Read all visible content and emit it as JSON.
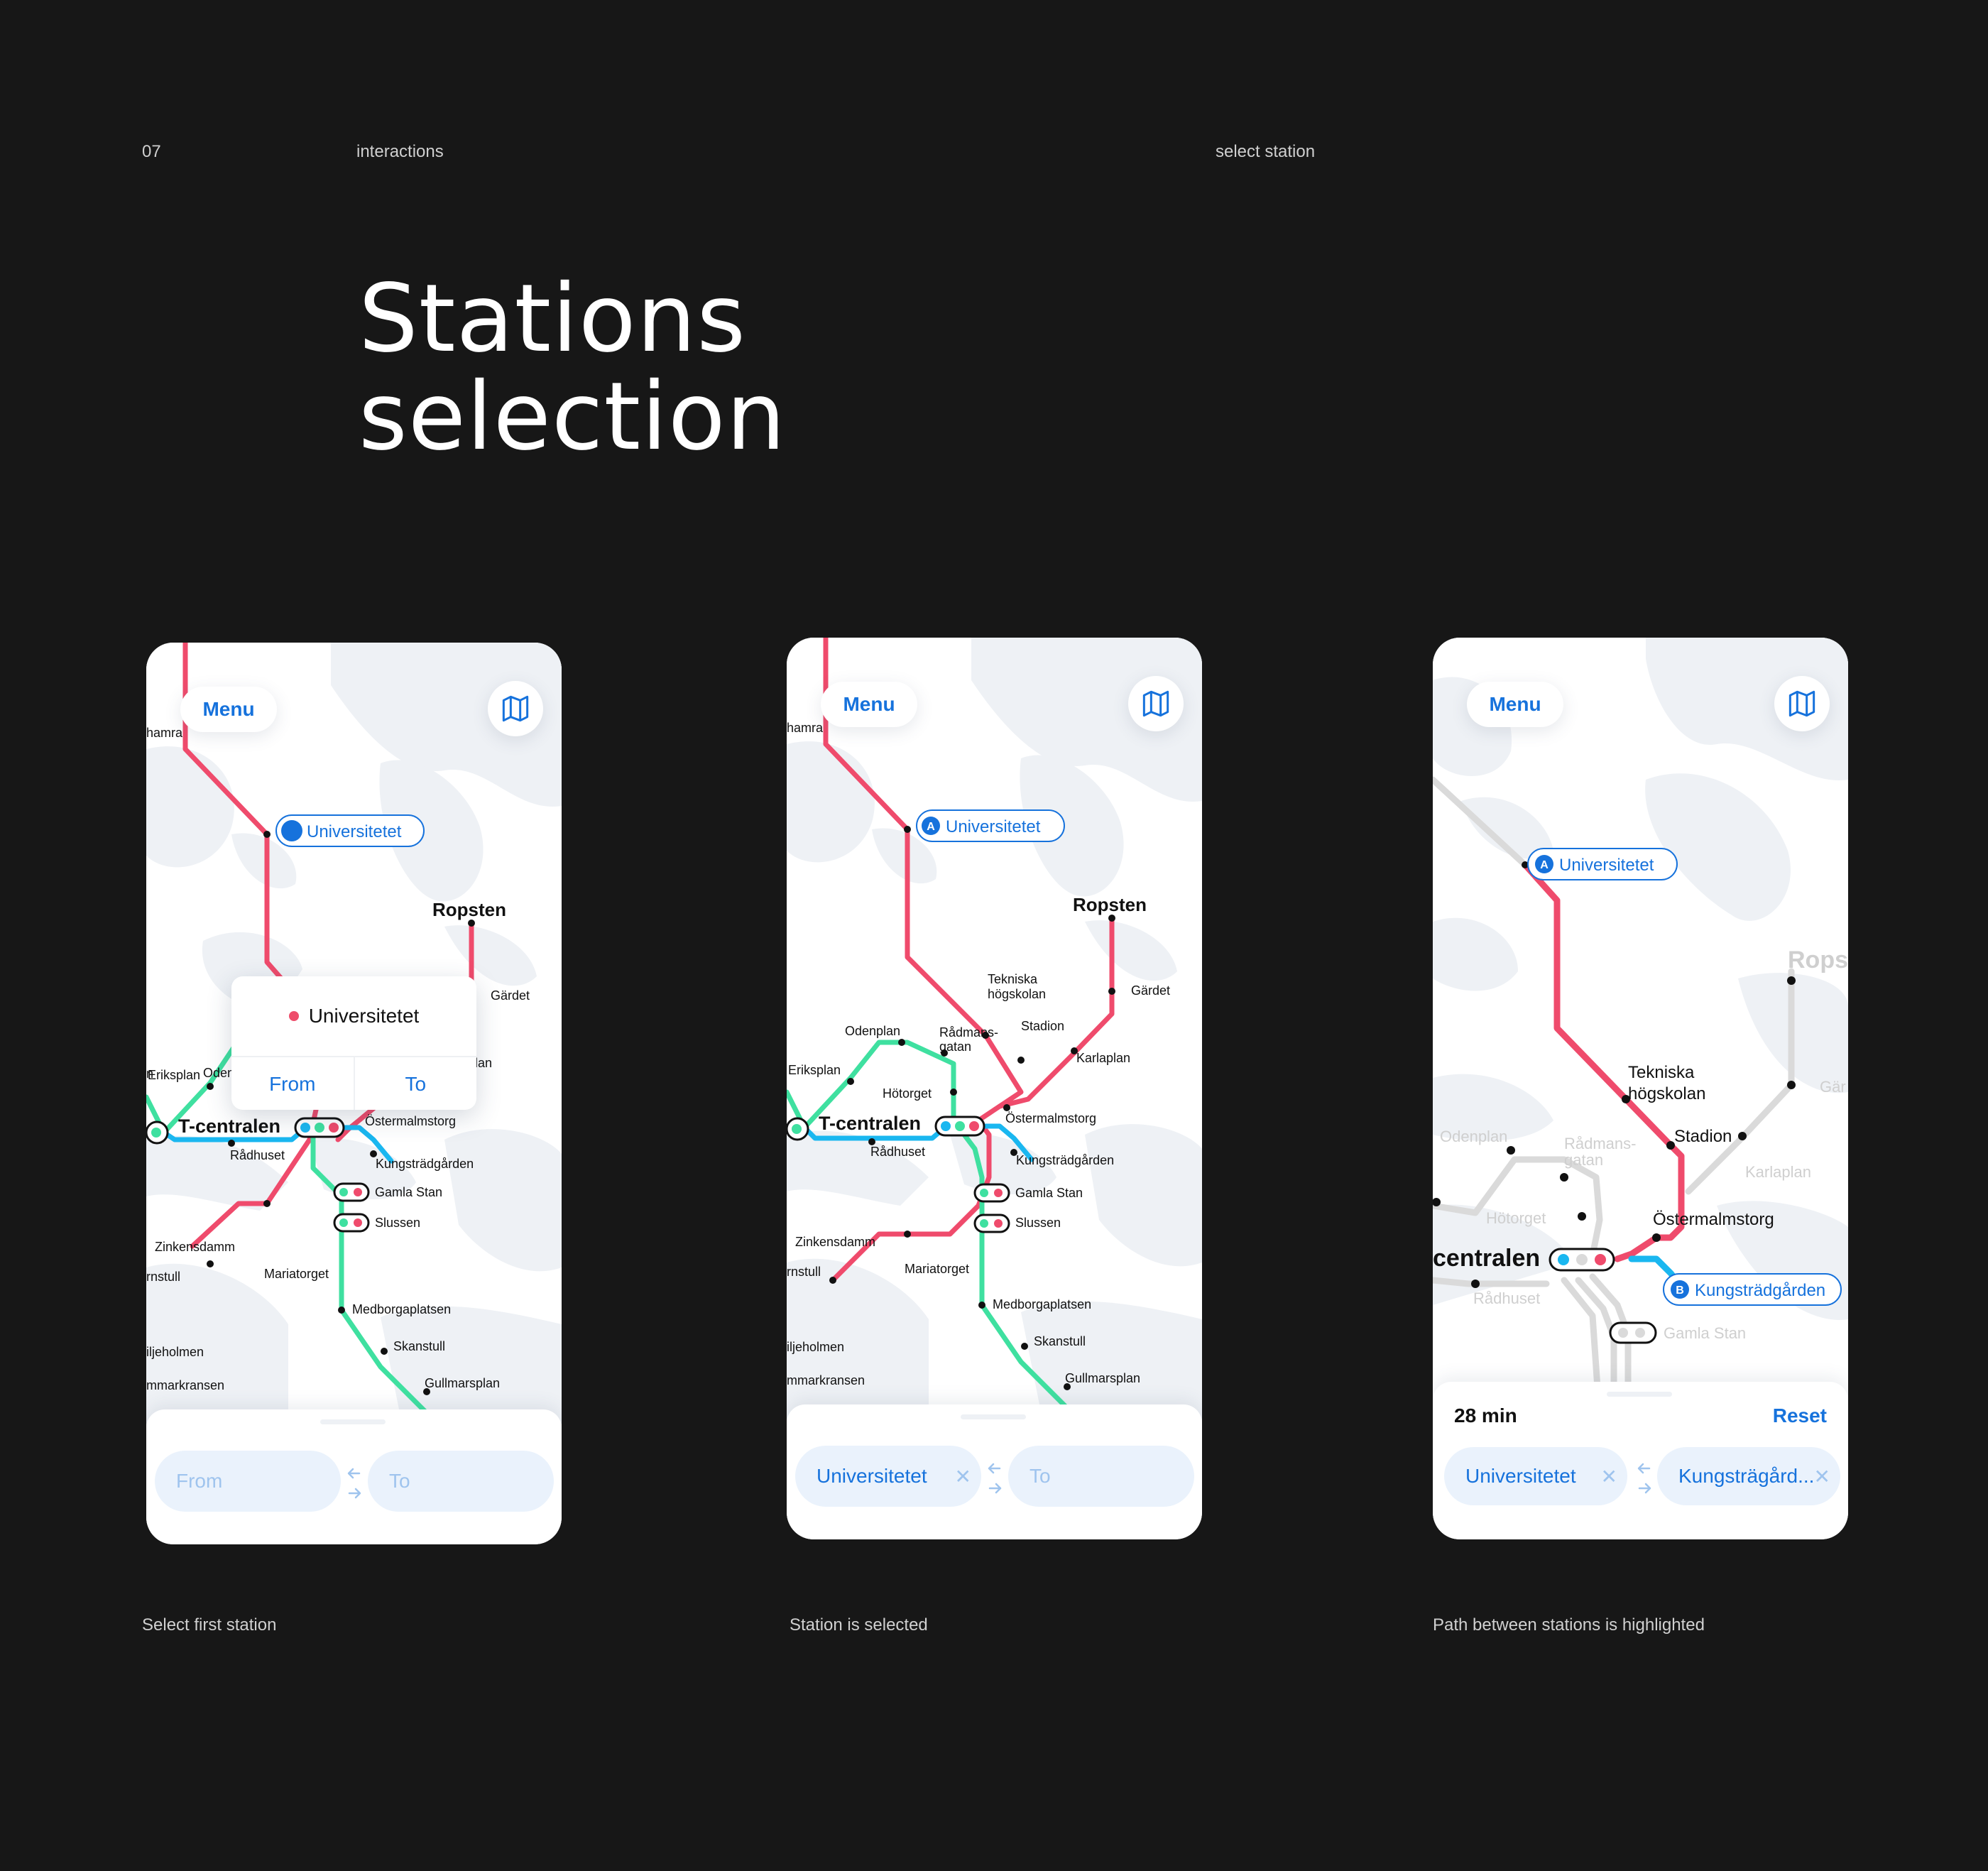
{
  "header": {
    "page_number": "07",
    "section": "interactions",
    "topic": "select station",
    "title_line1": "Stations",
    "title_line2": "selection"
  },
  "screens": [
    {
      "caption": "Select first station",
      "menu_label": "Menu",
      "map_button_icon": "map-icon",
      "popup": {
        "station": "Universitetet",
        "from_label": "From",
        "to_label": "To"
      },
      "from_placeholder": "From",
      "to_placeholder": "To"
    },
    {
      "caption": "Station is selected",
      "menu_label": "Menu",
      "map_button_icon": "map-icon",
      "from_value": "Universitetet",
      "to_placeholder": "To"
    },
    {
      "caption": "Path between stations is highlighted",
      "menu_label": "Menu",
      "map_button_icon": "map-icon",
      "duration": "28 min",
      "reset_label": "Reset",
      "from_value": "Universitetet",
      "to_value": "Kungsträgård...",
      "marker_a": "A",
      "marker_b": "B"
    }
  ],
  "map_labels": {
    "universitetet": "Universitetet",
    "ropsten": "Ropsten",
    "gardet": "Gärdet",
    "tekniska": "Tekniska",
    "hogskolan": "högskolan",
    "stadion": "Stadion",
    "karlaplan": "Karlaplan",
    "odenplan": "Odenplan",
    "radmans": "Rådmans-",
    "gatan": "gatan",
    "eriksplan": "Eriksplan",
    "hotorget": "Hötorget",
    "tcentralen": "T-centralen",
    "centralen": "centralen",
    "radhuset": "Rådhuset",
    "ostermalmstorg": "Östermalmstorg",
    "kungstradgarden": "Kungsträdgården",
    "gamlastan": "Gamla Stan",
    "slussen": "Slussen",
    "zinkensdamm": "Zinkensdamm",
    "hornstull": "rnstull",
    "mariatorget": "Mariatorget",
    "medborgarplatsen": "Medborgaplatsen",
    "skanstull": "Skanstull",
    "gullmarsplan": "Gullmarsplan",
    "liljeholmen": "iljeholmen",
    "midsommar": "mmarkransen",
    "hamra": "hamra",
    "rops_partial": "Rops",
    "gar_partial": "Gär"
  },
  "colors": {
    "red_line": "#ef4b6c",
    "green_line": "#3fe0a0",
    "blue_line": "#1ab7f0",
    "accent": "#1672dc",
    "background": "#171717",
    "inactive_line": "#dadada"
  }
}
